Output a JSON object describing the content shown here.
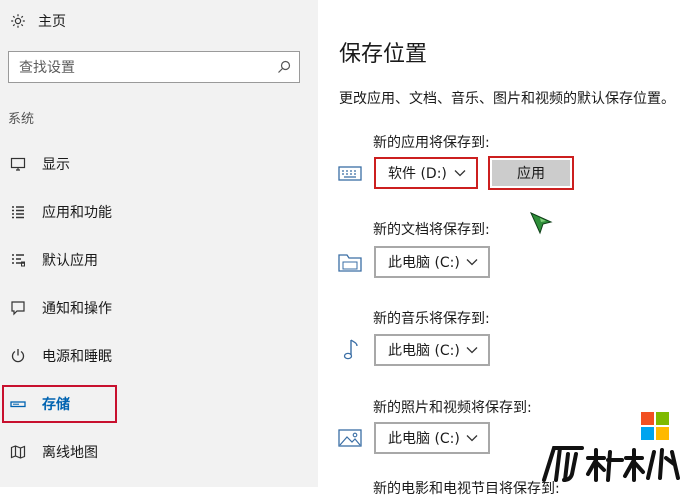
{
  "sidebar": {
    "home_label": "主页",
    "search_placeholder": "查找设置",
    "group_label": "系统",
    "items": [
      {
        "label": "显示",
        "icon": "monitor-icon"
      },
      {
        "label": "应用和功能",
        "icon": "apps-list-icon"
      },
      {
        "label": "默认应用",
        "icon": "default-apps-icon"
      },
      {
        "label": "通知和操作",
        "icon": "notification-icon"
      },
      {
        "label": "电源和睡眠",
        "icon": "power-icon"
      },
      {
        "label": "存储",
        "icon": "storage-icon",
        "active": true
      },
      {
        "label": "离线地图",
        "icon": "map-icon"
      }
    ]
  },
  "main": {
    "title": "保存位置",
    "description": "更改应用、文档、音乐、图片和视频的默认保存位置。",
    "sections": [
      {
        "label": "新的应用将保存到:",
        "value": "软件 (D:)",
        "icon": "keyboard-icon"
      },
      {
        "label": "新的文档将保存到:",
        "value": "此电脑 (C:)",
        "icon": "documents-icon"
      },
      {
        "label": "新的音乐将保存到:",
        "value": "此电脑 (C:)",
        "icon": "music-note-icon"
      },
      {
        "label": "新的照片和视频将保存到:",
        "value": "此电脑 (C:)",
        "icon": "photo-icon"
      }
    ],
    "apply_label": "应用",
    "partial_label": "新的电影和电视节目将保存到:"
  },
  "colors": {
    "accent": "#0063b1",
    "highlight_border": "#cc1f1f",
    "sidebar_bg": "#f2f2f2",
    "button_bg": "#cccccc"
  }
}
